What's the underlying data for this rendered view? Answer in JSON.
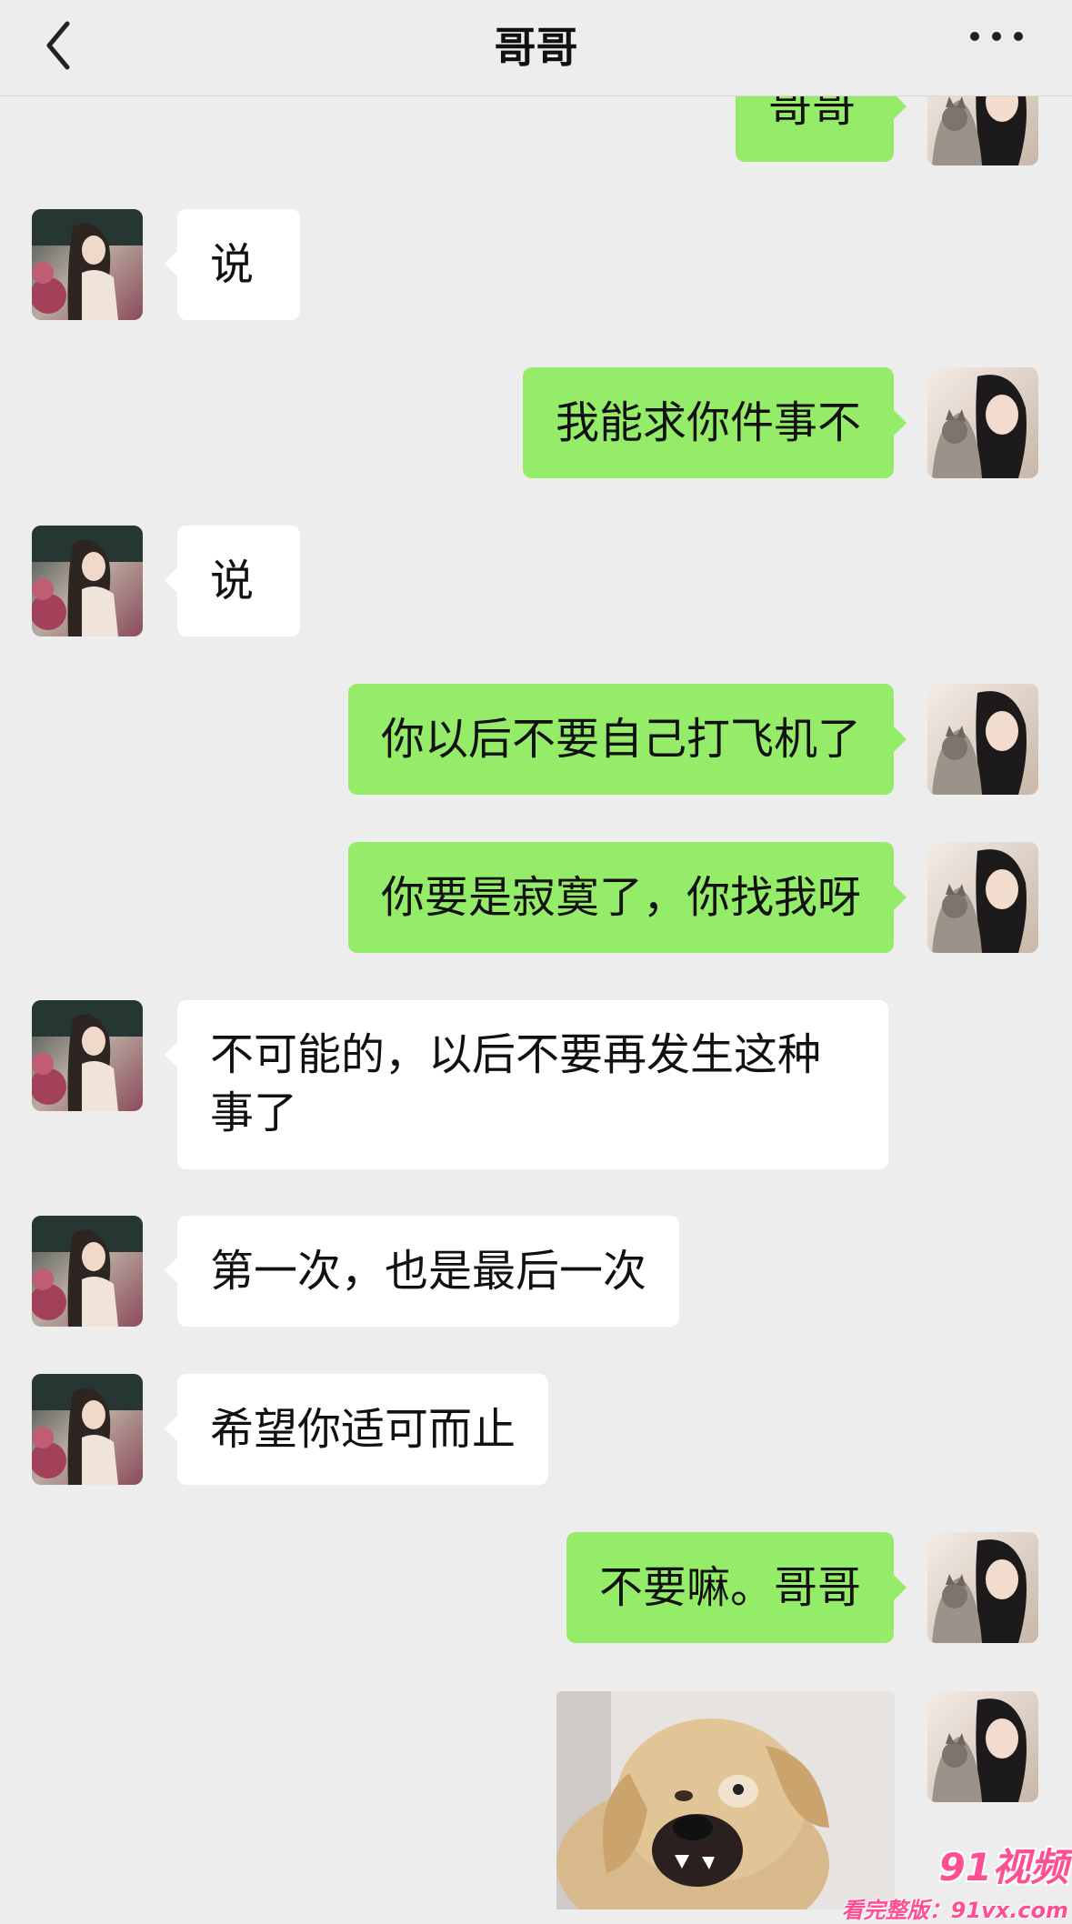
{
  "header": {
    "title": "哥哥"
  },
  "messages": [
    {
      "from": "me",
      "text": "哥哥"
    },
    {
      "from": "other",
      "text": "说"
    },
    {
      "from": "me",
      "text": "我能求你件事不"
    },
    {
      "from": "other",
      "text": "说"
    },
    {
      "from": "me",
      "text": "你以后不要自己打飞机了"
    },
    {
      "from": "me",
      "text": "你要是寂寞了，你找我呀"
    },
    {
      "from": "other",
      "text": "不可能的，以后不要再发生这种事了"
    },
    {
      "from": "other",
      "text": "第一次，也是最后一次"
    },
    {
      "from": "other",
      "text": "希望你适可而止"
    },
    {
      "from": "me",
      "text": "不要嘛。哥哥"
    },
    {
      "from": "me",
      "type": "image",
      "image": "dog-sticker"
    }
  ],
  "watermark": {
    "brand": "91视频",
    "sub": "看完整版：91vx.com"
  },
  "colors": {
    "background": "#ededed",
    "sent_bubble": "#95ec69",
    "received_bubble": "#ffffff"
  }
}
